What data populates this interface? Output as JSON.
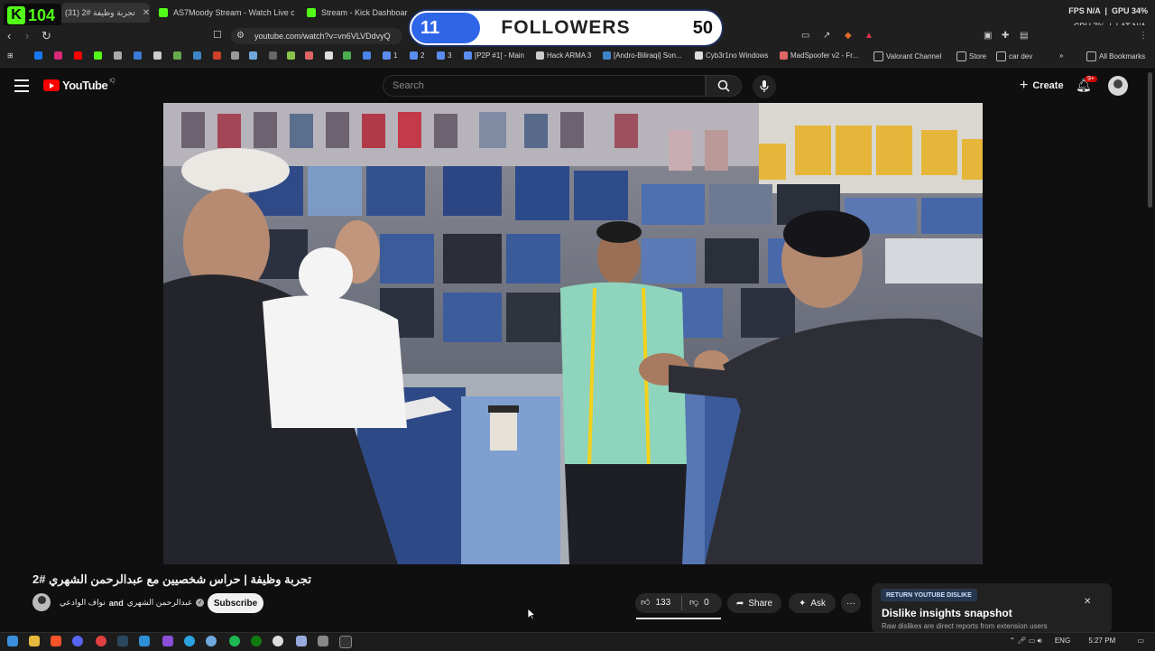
{
  "browser": {
    "kick_badge_number": "104",
    "tabs": [
      {
        "title": "تجربة وظيفة #2 (31)",
        "active": true
      },
      {
        "title": "AS7Moody Stream - Watch Live on K",
        "active": false
      },
      {
        "title": "Stream - Kick Dashboard",
        "active": false
      }
    ],
    "stats": {
      "fps_label": "FPS",
      "fps_value": "N/A",
      "gpu_label": "GPU",
      "gpu_value": "34%",
      "cpu_label": "CPU",
      "cpu_value": "7%",
      "lat_label": "LAT",
      "lat_value": "N/A"
    },
    "url": "youtube.com/watch?v=vn6VLVDdvyQ",
    "bookmarks": [
      {
        "label": "1"
      },
      {
        "label": "2"
      },
      {
        "label": "3"
      },
      {
        "label": "[P2P #1] - Main"
      },
      {
        "label": "Hack ARMA 3"
      },
      {
        "label": "[Andro-Biliraqi] Son..."
      },
      {
        "label": "Cyb3r1no Windows"
      },
      {
        "label": "MadSpoofer v2 - Fr..."
      },
      {
        "label": "Valorant Channel"
      },
      {
        "label": "Store"
      },
      {
        "label": "car dev"
      },
      {
        "label": "All Bookmarks"
      }
    ]
  },
  "followers_overlay": {
    "current": "11",
    "label": "FOLLOWERS",
    "goal": "50",
    "progress": 0.22
  },
  "youtube": {
    "logo": "YouTube",
    "country": "IQ",
    "search_placeholder": "Search",
    "create_label": "Create",
    "notif_badge": "9+",
    "video": {
      "title": "تجربة وظيفة | حراس شخصيين مع عبدالرحمن الشهري #2",
      "channel_a": "نواف الوادعي",
      "and": "and",
      "channel_b": "عبدالرحمن الشهري",
      "subscribe": "Subscribe",
      "likes": "133",
      "dislikes": "0",
      "share": "Share",
      "ask": "Ask"
    },
    "ryd": {
      "tag": "RETURN YOUTUBE DISLIKE",
      "title": "Dislike insights snapshot",
      "subtitle": "Raw dislikes are direct reports from extension users"
    }
  },
  "taskbar": {
    "lang": "ENG",
    "time": "5:27 PM"
  },
  "colors": {
    "kick_green": "#53fc18",
    "follower_blue": "#2f66e8",
    "yt_red": "#ff0000"
  }
}
